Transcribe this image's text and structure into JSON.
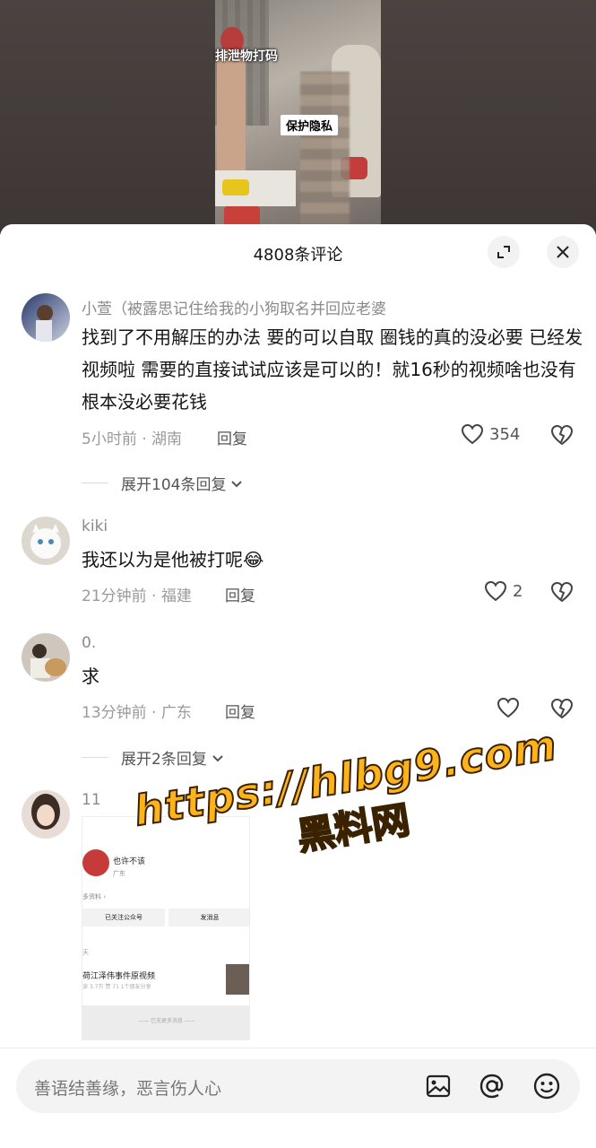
{
  "video": {
    "overlay_top": "排泄物打码",
    "overlay_privacy": "保护隐私"
  },
  "sheet": {
    "title": "4808条评论"
  },
  "comments": [
    {
      "username": "小萱（被露思记住给我的小狗取名并回应老婆",
      "text": "找到了不用解压的办法 要的可以自取 圈钱的真的没必要 已经发视频啦 需要的直接试试应该是可以的！就16秒的视频啥也没有 根本没必要花钱",
      "meta": "5小时前 · 湖南",
      "reply_label": "回复",
      "likes": "354",
      "expand_label": "展开104条回复"
    },
    {
      "username": "kiki",
      "text": "我还以为是他被打呢",
      "emoji": "😂",
      "meta": "21分钟前 · 福建",
      "reply_label": "回复",
      "likes": "2"
    },
    {
      "username": "0.",
      "text": "求",
      "meta": "13分钟前 · 广东",
      "reply_label": "回复",
      "likes": "",
      "expand_label": "展开2条回复"
    },
    {
      "username": "11"
    }
  ],
  "embed": {
    "name": "也许不该",
    "location": "广东",
    "data_link": "多资料 ›",
    "btn_follow": "已关注公众号",
    "btn_message": "发消息",
    "tag": "天",
    "title": "荷江泽伟事件原视频",
    "stats": "读 3.7万  赞 71  1个朋友分享",
    "footer": "—— 已无更多消息 ——"
  },
  "watermark": {
    "url": "https://hlbg9.com",
    "name": "黑料网"
  },
  "input": {
    "placeholder": "善语结善缘，恶言伤人心"
  }
}
